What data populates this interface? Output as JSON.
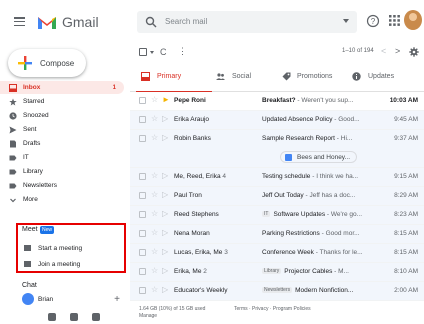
{
  "app": {
    "name": "Gmail",
    "colors": {
      "accent_red": "#d93025",
      "brand_blue": "#4285f4",
      "highlight": "#e60000"
    }
  },
  "header": {
    "search_placeholder": "Search mail",
    "icons": [
      "menu-icon",
      "search-icon",
      "help-icon",
      "apps-icon"
    ]
  },
  "sidebar": {
    "compose_label": "Compose",
    "items": [
      {
        "label": "Inbox",
        "count": "1",
        "icon": "inbox-icon",
        "active": true
      },
      {
        "label": "Starred",
        "icon": "star-icon"
      },
      {
        "label": "Snoozed",
        "icon": "clock-icon"
      },
      {
        "label": "Sent",
        "icon": "send-icon"
      },
      {
        "label": "Drafts",
        "icon": "draft-icon"
      },
      {
        "label": "IT",
        "icon": "label-icon"
      },
      {
        "label": "Library",
        "icon": "label-icon"
      },
      {
        "label": "Newsletters",
        "icon": "label-icon"
      },
      {
        "label": "More",
        "icon": "chevron-down-icon"
      }
    ],
    "meet": {
      "title": "Meet",
      "badge": "New",
      "items": [
        {
          "label": "Start a meeting",
          "icon": "video-icon"
        },
        {
          "label": "Join a meeting",
          "icon": "keyboard-icon"
        }
      ]
    },
    "chat": {
      "title": "Chat",
      "user": "Brian",
      "add": "+"
    }
  },
  "toolbar": {
    "refresh": "C",
    "more": "⋮",
    "count": "1–10 of 194",
    "prev": "<",
    "next": ">"
  },
  "tabs": [
    {
      "label": "Primary",
      "active": true
    },
    {
      "label": "Social"
    },
    {
      "label": "Promotions"
    },
    {
      "label": "Updates"
    }
  ],
  "emails": [
    {
      "sender": "Pepe Roni",
      "count": "",
      "subject": "Breakfast?",
      "snippet": " - Weren't you sup...",
      "label": "",
      "time": "10:03 AM",
      "unread": true,
      "important": true
    },
    {
      "sender": "Erika Araujo",
      "count": "",
      "subject": "Updated Absence Policy",
      "snippet": " - Good...",
      "label": "",
      "time": "9:45 AM",
      "unread": false
    },
    {
      "sender": "Robin Banks",
      "count": "",
      "subject": "Sample Research Report",
      "snippet": " - Hi...",
      "label": "",
      "time": "9:37 AM",
      "unread": false,
      "attachment": "Bees and Honey..."
    },
    {
      "sender": "Me, Reed, Erika",
      "count": "4",
      "subject": "Testing schedule",
      "snippet": " - I think we ha...",
      "label": "",
      "time": "9:15 AM",
      "unread": false
    },
    {
      "sender": "Paul Tron",
      "count": "",
      "subject": "Jeff Out Today",
      "snippet": " - Jeff has a doc...",
      "label": "",
      "time": "8:29 AM",
      "unread": false
    },
    {
      "sender": "Reed Stephens",
      "count": "",
      "subject": "Software Updates",
      "snippet": " - We're go...",
      "label": "IT",
      "time": "8:23 AM",
      "unread": false
    },
    {
      "sender": "Nena Moran",
      "count": "",
      "subject": "Parking Restrictions",
      "snippet": " - Good mor...",
      "label": "",
      "time": "8:15 AM",
      "unread": false
    },
    {
      "sender": "Lucas, Erika, Me",
      "count": "3",
      "subject": "Conference Week",
      "snippet": " - Thanks for le...",
      "label": "",
      "time": "8:15 AM",
      "unread": false
    },
    {
      "sender": "Erika, Me",
      "count": "2",
      "subject": "Projector Cables",
      "snippet": " - M...",
      "label": "Library",
      "time": "8:10 AM",
      "unread": false
    },
    {
      "sender": "Educator's Weekly",
      "count": "",
      "subject": "Modern Nonfiction...",
      "snippet": "",
      "label": "Newsletters",
      "time": "2:00 AM",
      "unread": false
    }
  ],
  "footer": {
    "storage": "1.64 GB (10%) of 15 GB used",
    "manage": "Manage",
    "links": "Terms · Privacy · Program Policies"
  }
}
